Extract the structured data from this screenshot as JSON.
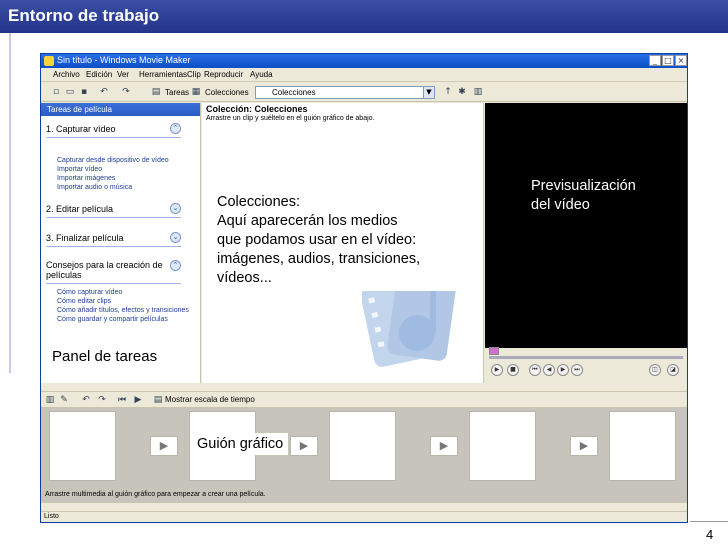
{
  "slide": {
    "title": "Entorno de trabajo",
    "page_number": "4"
  },
  "app": {
    "window_title": "Sin título - Windows Movie Maker",
    "menu": [
      "Archivo",
      "Edición",
      "Ver",
      "Herramientas",
      "Clip",
      "Reproducir",
      "Ayuda"
    ],
    "toolbar": {
      "tasks_label": "Tareas",
      "collections_label": "Colecciones"
    },
    "task_panel": {
      "header": "Tareas de película",
      "sections": [
        {
          "title": "1. Capturar vídeo",
          "links": [
            "Capturar desde dispositivo de vídeo",
            "Importar vídeo",
            "Importar imágenes",
            "Importar audio o música"
          ]
        },
        {
          "title": "2. Editar película",
          "links": []
        },
        {
          "title": "3. Finalizar película",
          "links": []
        },
        {
          "title": "Consejos para la creación de películas",
          "links": [
            "Cómo capturar vídeo",
            "Cómo editar clips",
            "Cómo añadir títulos, efectos y transiciones",
            "Cómo guardar y compartir películas"
          ]
        }
      ]
    },
    "collection": {
      "title": "Colección: Colecciones",
      "subtitle": "Arrastre un clip y suéltelo en el guión gráfico de abajo."
    },
    "storyboard": {
      "toolbar_label": "Mostrar escala de tiempo",
      "hint": "Arrastre multimedia al guión gráfico para empezar a crear una película."
    },
    "status": "Listo"
  },
  "annotations": {
    "collections": [
      "Colecciones:",
      "Aquí aparecerán los medios",
      "que podamos usar en el vídeo:",
      "imágenes, audios, transiciones,",
      "vídeos..."
    ],
    "preview": [
      "Previsualización",
      "del vídeo"
    ],
    "tasks_panel": "Panel de tareas",
    "storyboard": "Guión gráfico"
  },
  "colors": {
    "slide_header": "#2a3c96",
    "xp_titlebar": "#0b4fc6",
    "preview_bg": "#000000"
  }
}
